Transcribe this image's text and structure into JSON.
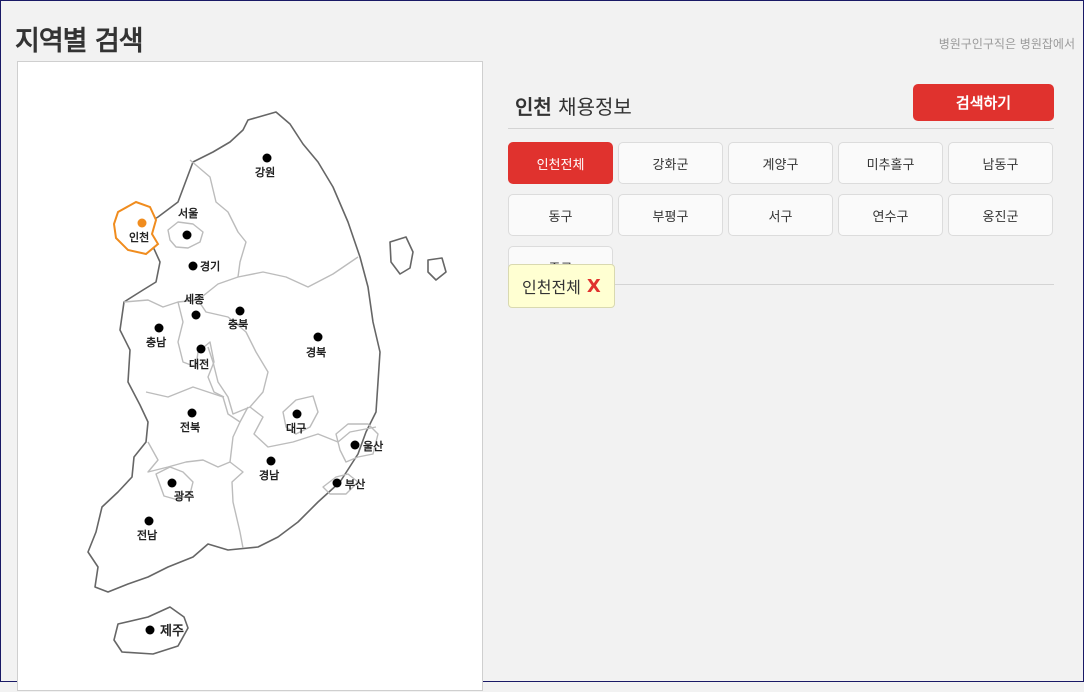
{
  "header": {
    "title": "지역별 검색",
    "tagline": "병원구인구직은 병원잡에서"
  },
  "map": {
    "selected_region": "인천",
    "regions": {
      "gangwon": "강원",
      "seoul": "서울",
      "incheon": "인천",
      "gyeonggi": "경기",
      "sejong": "세종",
      "chungbuk": "충북",
      "chungnam": "충남",
      "daejeon": "대전",
      "gyeongbuk": "경북",
      "daegu": "대구",
      "jeonbuk": "전북",
      "ulsan": "울산",
      "gyeongnam": "경남",
      "busan": "부산",
      "gwangju": "광주",
      "jeonnam": "전남",
      "jeju": "제주"
    },
    "colors": {
      "selected": "#f08c1e",
      "outline": "#666666"
    }
  },
  "panel": {
    "title_region": "인천",
    "title_suffix": " 채용정보",
    "search_label": "검색하기",
    "districts": [
      {
        "label": "인천전체",
        "active": true
      },
      {
        "label": "강화군",
        "active": false
      },
      {
        "label": "계양구",
        "active": false
      },
      {
        "label": "미추홀구",
        "active": false
      },
      {
        "label": "남동구",
        "active": false
      },
      {
        "label": "동구",
        "active": false
      },
      {
        "label": "부평구",
        "active": false
      },
      {
        "label": "서구",
        "active": false
      },
      {
        "label": "연수구",
        "active": false
      },
      {
        "label": "옹진군",
        "active": false
      },
      {
        "label": "중구",
        "active": false
      }
    ],
    "selected_chip": {
      "label": "인천전체",
      "remove_label": "X"
    }
  },
  "colors": {
    "accent": "#e0322e",
    "chip_bg": "#ffffd2"
  }
}
